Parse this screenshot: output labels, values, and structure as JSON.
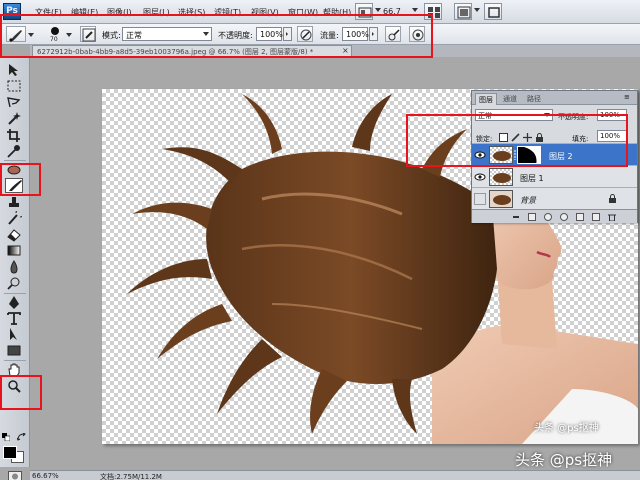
{
  "menubar": {
    "logo": "Ps",
    "items": [
      "文件(F)",
      "编辑(E)",
      "图像(I)",
      "图层(L)",
      "选择(S)",
      "滤镜(T)",
      "视图(V)",
      "窗口(W)",
      "帮助(H)"
    ],
    "zoom": "66.7"
  },
  "options": {
    "brush_size": "70",
    "mode_label": "模式:",
    "mode_value": "正常",
    "opacity_label": "不透明度:",
    "opacity_value": "100%",
    "flow_label": "流量:",
    "flow_value": "100%"
  },
  "document_tab": {
    "title": "6272912b-0bab-4bb9-a8d5-39eb1003796a.jpeg @ 66.7% (图层 2, 图层蒙版/8) *",
    "close": "×"
  },
  "layers_panel": {
    "tabs": [
      "图层",
      "通道",
      "路径"
    ],
    "blend_mode": "正常",
    "opacity_label": "不透明度:",
    "opacity_value": "100%",
    "lock_label": "锁定:",
    "fill_label": "填充:",
    "fill_value": "100%",
    "layers": [
      {
        "name": "图层 2",
        "selected": true,
        "has_mask": true
      },
      {
        "name": "图层 1",
        "selected": false,
        "has_mask": false
      },
      {
        "name": "背景",
        "selected": false,
        "has_mask": false,
        "locked": true
      }
    ]
  },
  "statusbar": {
    "zoom": "66.67%",
    "doc_info": "文档:2.75M/11.2M"
  },
  "watermarks": {
    "small": "头条 @ps抠神",
    "large": "头条 @ps抠神"
  },
  "colors": {
    "annotation": "#e8141d",
    "selected_layer": "#3b74c9",
    "foreground": "#000000",
    "background": "#ffffff"
  },
  "icons": [
    "brush-icon",
    "move-icon",
    "marquee-icon",
    "lasso-icon",
    "magic-wand-icon",
    "crop-icon",
    "eyedropper-icon",
    "healing-icon",
    "clone-stamp-icon",
    "history-brush-icon",
    "eraser-icon",
    "gradient-icon",
    "blur-icon",
    "dodge-icon",
    "pen-icon",
    "type-icon",
    "path-select-icon",
    "shape-icon",
    "hand-icon",
    "zoom-icon",
    "eye-icon",
    "lock-icon",
    "link-icon",
    "trash-icon"
  ]
}
